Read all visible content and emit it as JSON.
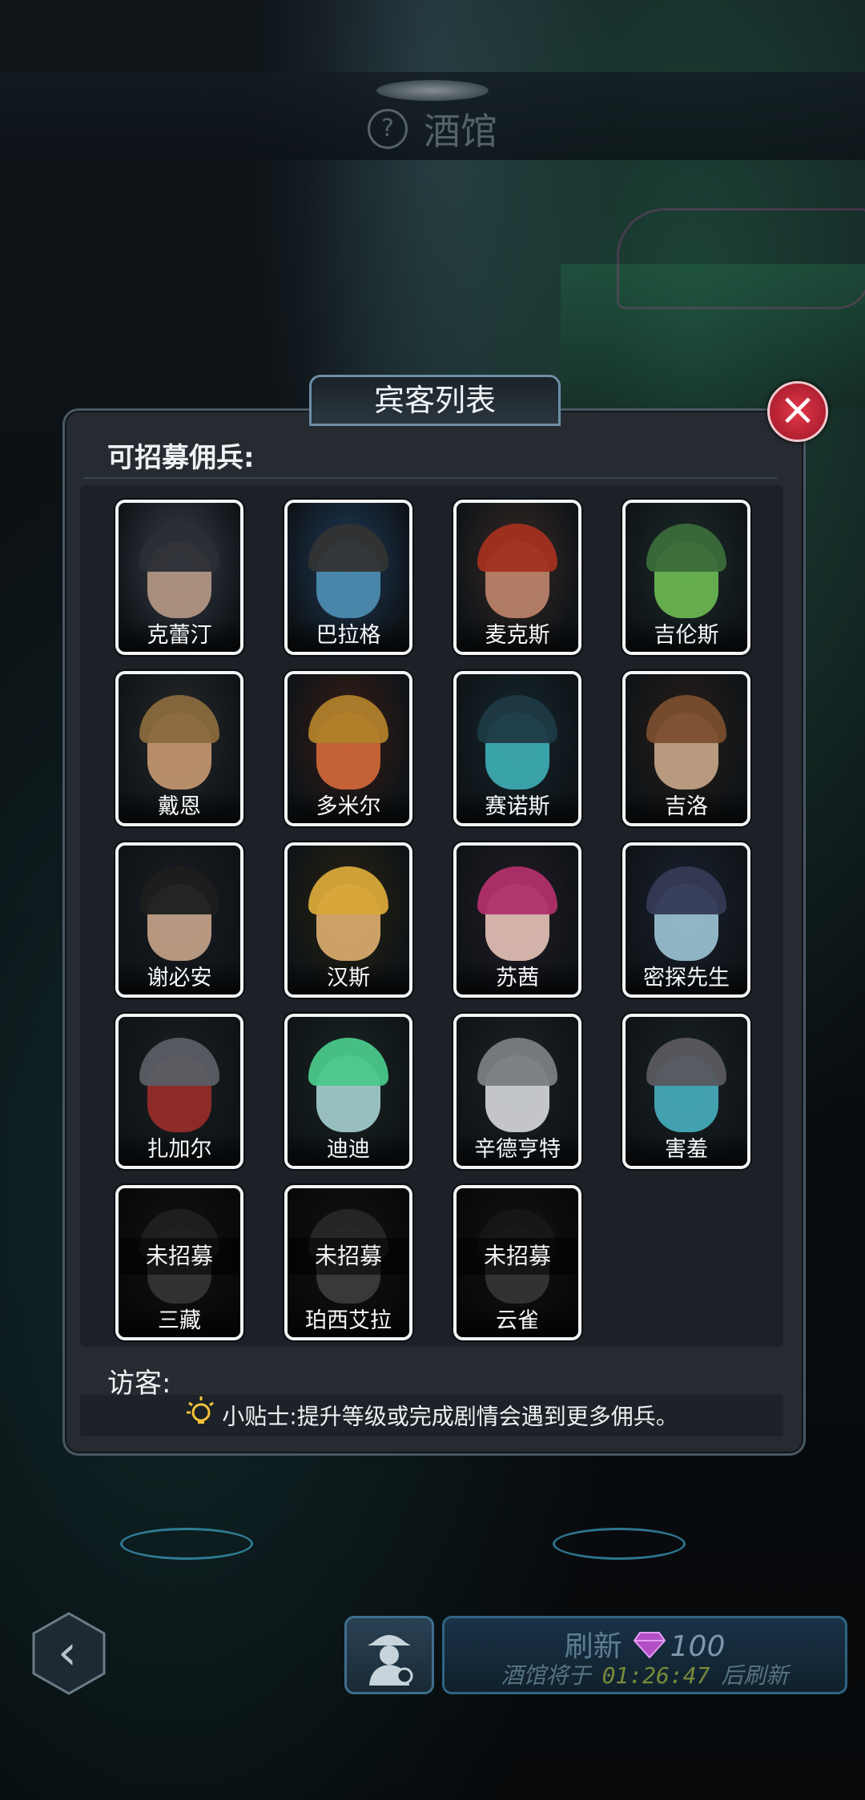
{
  "header": {
    "help_icon": "?",
    "title": "酒馆"
  },
  "dialog": {
    "title": "宾客列表",
    "close_icon": "×",
    "recruitable_label": "可招募佣兵:",
    "visitors_label": "访客:",
    "tip_text": "小贴士:提升等级或完成剧情会遇到更多佣兵。"
  },
  "mercenaries": [
    {
      "name": "克蕾汀",
      "recruited": true,
      "colors": [
        "#3b3f4a",
        "#b89a86",
        "#2a2e36"
      ]
    },
    {
      "name": "巴拉格",
      "recruited": true,
      "colors": [
        "#1f3b5a",
        "#4f8fb6",
        "#333"
      ]
    },
    {
      "name": "麦克斯",
      "recruited": true,
      "colors": [
        "#3a2a26",
        "#c0856c",
        "#a33020"
      ]
    },
    {
      "name": "吉伦斯",
      "recruited": true,
      "colors": [
        "#1f2c2a",
        "#6dbb52",
        "#3a6b3a"
      ]
    },
    {
      "name": "戴恩",
      "recruited": true,
      "colors": [
        "#2a2a2a",
        "#c99a72",
        "#8a6a3e"
      ]
    },
    {
      "name": "多米尔",
      "recruited": true,
      "colors": [
        "#3a1e16",
        "#d46a3a",
        "#b0802a"
      ]
    },
    {
      "name": "赛诺斯",
      "recruited": true,
      "colors": [
        "#16282e",
        "#3fb0b8",
        "#1e3a44"
      ]
    },
    {
      "name": "吉洛",
      "recruited": true,
      "colors": [
        "#2a1e18",
        "#caa889",
        "#7a4e2e"
      ]
    },
    {
      "name": "谢必安",
      "recruited": true,
      "colors": [
        "#1a1d22",
        "#c8a58c",
        "#1e1e1e"
      ]
    },
    {
      "name": "汉斯",
      "recruited": true,
      "colors": [
        "#2a2410",
        "#e0b070",
        "#d8a83a"
      ]
    },
    {
      "name": "苏茜",
      "recruited": true,
      "colors": [
        "#261c26",
        "#e8c4b8",
        "#b0306a"
      ]
    },
    {
      "name": "密探先生",
      "recruited": true,
      "colors": [
        "#1c2230",
        "#9cc6d6",
        "#353a55"
      ]
    },
    {
      "name": "扎加尔",
      "recruited": true,
      "colors": [
        "#1e1e1e",
        "#9a2e2a",
        "#5a5e64"
      ]
    },
    {
      "name": "迪迪",
      "recruited": true,
      "colors": [
        "#1a2624",
        "#a6d0d0",
        "#4ac88a"
      ]
    },
    {
      "name": "辛德亨特",
      "recruited": true,
      "colors": [
        "#1e2228",
        "#d6d8da",
        "#7a7e84"
      ]
    },
    {
      "name": "害羞",
      "recruited": true,
      "colors": [
        "#1a2226",
        "#48b0c0",
        "#58585e"
      ]
    },
    {
      "name": "三藏",
      "recruited": false,
      "status": "未招募",
      "colors": [
        "#2a2a2a",
        "#777",
        "#444"
      ]
    },
    {
      "name": "珀西艾拉",
      "recruited": false,
      "status": "未招募",
      "colors": [
        "#2a2a2a",
        "#888",
        "#555"
      ]
    },
    {
      "name": "云雀",
      "recruited": false,
      "status": "未招募",
      "colors": [
        "#2a2a2a",
        "#777",
        "#333"
      ]
    }
  ],
  "footer": {
    "back_icon": "‹",
    "refresh_label": "刷新",
    "refresh_cost": "100",
    "refresh_currency_icon": "gem-icon",
    "timer_prefix": "酒馆将于",
    "timer_value": "01:26:47",
    "timer_suffix": "后刷新"
  }
}
